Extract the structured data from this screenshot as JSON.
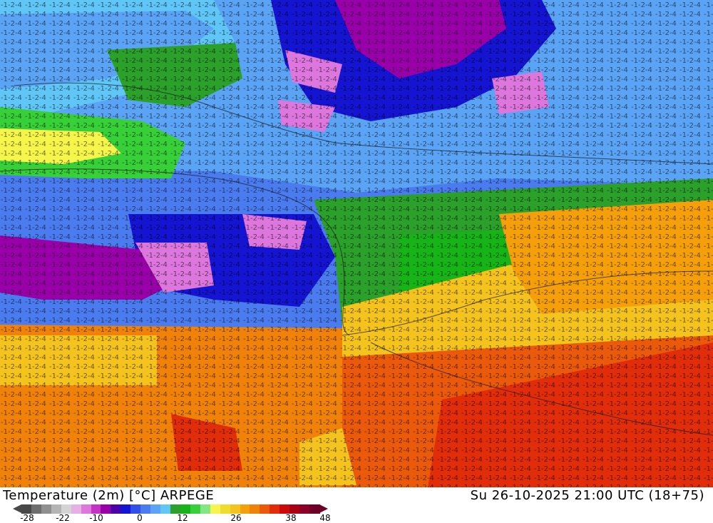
{
  "map": {
    "footer_title": "Temperature (2m) [°C] ARPEGE",
    "footer_datetime": "Su 26-10-2025 21:00 UTC (18+75)",
    "legend": {
      "tick_labels": [
        "-28",
        "-22",
        "-10",
        "0",
        "12",
        "26",
        "38",
        "48"
      ],
      "colors": [
        "#474747",
        "#6e6e6e",
        "#8f8f8f",
        "#b4b4b4",
        "#d4d4d4",
        "#e6b0e6",
        "#dd77dd",
        "#c632c6",
        "#9900aa",
        "#4b00a8",
        "#1414d2",
        "#2f4fe8",
        "#4a7cf0",
        "#5aa3f5",
        "#60c6f8",
        "#2ba02b",
        "#16b416",
        "#38d038",
        "#82e682",
        "#f5f54b",
        "#f0dc2d",
        "#f5c31e",
        "#f5a00a",
        "#f0820a",
        "#eb5a0a",
        "#e12d0a",
        "#cd0a0a",
        "#aa0014",
        "#8c0028",
        "#6e0028"
      ]
    }
  }
}
